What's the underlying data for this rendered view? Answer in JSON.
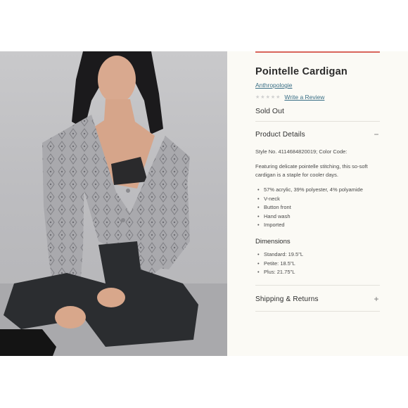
{
  "product": {
    "title": "Pointelle Cardigan",
    "brand": "Anthropologie",
    "review_link": "Write a Review",
    "rating_stars": 0,
    "status": "Sold Out"
  },
  "details": {
    "heading": "Product Details",
    "toggle_icon": "minus-icon",
    "toggle_glyph": "−",
    "style_line": "Style No. 4114684820019; Color Code:",
    "description": "Featuring delicate pointelle stitching, this so-soft cardigan is a staple for cooler days.",
    "features": [
      "57% acrylic, 39% polyester, 4% polyamide",
      "V-neck",
      "Button front",
      "Hand wash",
      "Imported"
    ]
  },
  "dimensions": {
    "heading": "Dimensions",
    "items": [
      "Standard: 19.5\"L",
      "Petite: 18.5\"L",
      "Plus: 21.75\"L"
    ]
  },
  "shipping": {
    "heading": "Shipping & Returns",
    "toggle_icon": "plus-icon",
    "toggle_glyph": "+"
  },
  "colors": {
    "link": "#3a6f86",
    "accent_rule": "#d8645b",
    "panel_bg": "#fbfaf5"
  }
}
